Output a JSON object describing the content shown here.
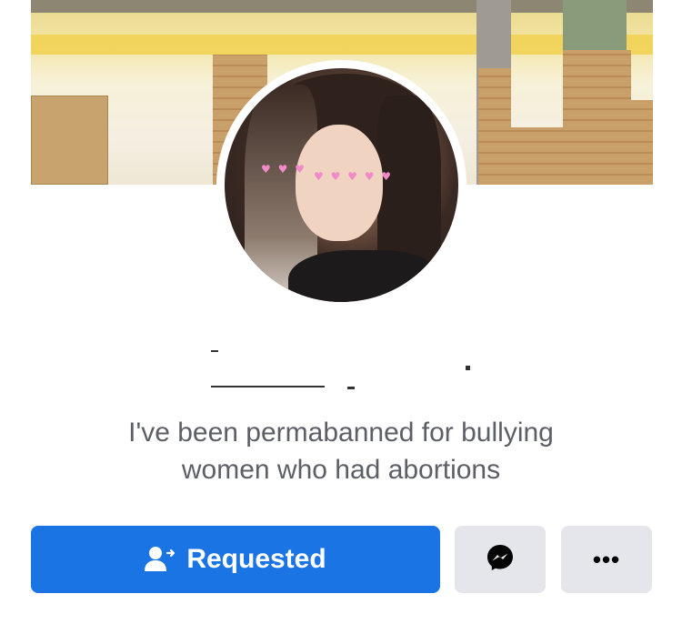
{
  "profile": {
    "bio_line1": "I've been permabanned for bullying",
    "bio_line2": "women who had abortions"
  },
  "actions": {
    "requested_label": "Requested",
    "requested_icon": "add-friend-icon",
    "messenger_icon": "messenger-icon",
    "more_icon": "more-icon",
    "more_label": "•••"
  },
  "colors": {
    "primary": "#1b74e4",
    "secondary_button": "#e4e6eb",
    "bio_text": "#5c5f66"
  }
}
